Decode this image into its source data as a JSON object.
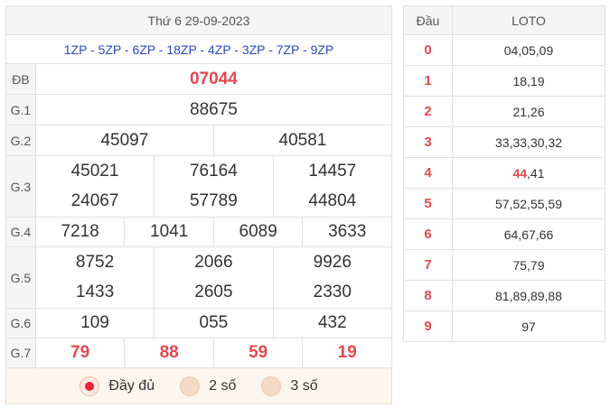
{
  "header": {
    "date": "Thứ 6 29-09-2023"
  },
  "codes": "1ZP - 5ZP - 6ZP - 18ZP - 4ZP - 3ZP - 7ZP - 9ZP",
  "prizes": {
    "db": {
      "label": "ĐB",
      "values": [
        "07044"
      ]
    },
    "g1": {
      "label": "G.1",
      "values": [
        "88675"
      ]
    },
    "g2": {
      "label": "G.2",
      "values": [
        "45097",
        "40581"
      ]
    },
    "g3": {
      "label": "G.3",
      "values": [
        "45021",
        "76164",
        "14457",
        "24067",
        "57789",
        "44804"
      ]
    },
    "g4": {
      "label": "G.4",
      "values": [
        "7218",
        "1041",
        "6089",
        "3633"
      ]
    },
    "g5": {
      "label": "G.5",
      "values": [
        "8752",
        "2066",
        "9926",
        "1433",
        "2605",
        "2330"
      ]
    },
    "g6": {
      "label": "G.6",
      "values": [
        "109",
        "055",
        "432"
      ]
    },
    "g7": {
      "label": "G.7",
      "values": [
        "79",
        "88",
        "59",
        "19"
      ]
    }
  },
  "options": [
    {
      "label": "Đầy đủ",
      "selected": true
    },
    {
      "label": "2 số",
      "selected": false
    },
    {
      "label": "3 số",
      "selected": false
    }
  ],
  "loto": {
    "head_label": "Đầu",
    "col_label": "LOTO",
    "rows": [
      {
        "dau": "0",
        "hot": "",
        "rest": "04,05,09"
      },
      {
        "dau": "1",
        "hot": "",
        "rest": "18,19"
      },
      {
        "dau": "2",
        "hot": "",
        "rest": "21,26"
      },
      {
        "dau": "3",
        "hot": "",
        "rest": "33,33,30,32"
      },
      {
        "dau": "4",
        "hot": "44",
        "rest": ",41"
      },
      {
        "dau": "5",
        "hot": "",
        "rest": "57,52,55,59"
      },
      {
        "dau": "6",
        "hot": "",
        "rest": "64,67,66"
      },
      {
        "dau": "7",
        "hot": "",
        "rest": "75,79"
      },
      {
        "dau": "8",
        "hot": "",
        "rest": "81,89,89,88"
      },
      {
        "dau": "9",
        "hot": "",
        "rest": "97"
      }
    ]
  },
  "colors": {
    "accent_red": "#e5484d",
    "code_blue": "#2d45c8",
    "header_bg": "#f5f5f5",
    "options_bg": "#fdf6ec"
  }
}
